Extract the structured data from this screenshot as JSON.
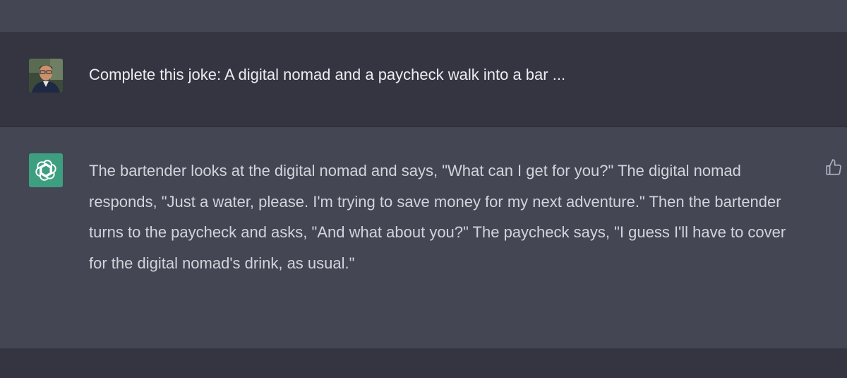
{
  "conversation": {
    "user_message": "Complete this joke: A digital nomad and a paycheck walk into a bar ...",
    "assistant_message": "The bartender looks at the digital nomad and says, \"What can I get for you?\" The digital nomad responds, \"Just a water, please. I'm trying to save money for my next adventure.\" Then the bartender turns to the paycheck and asks, \"And what about you?\" The paycheck says, \"I guess I'll have to cover for the digital nomad's drink, as usual.\""
  },
  "icons": {
    "user_avatar": "user-avatar-photo",
    "assistant_avatar": "openai-logo-icon",
    "feedback": "thumbs-up-icon"
  },
  "colors": {
    "accent": "#3e9f80",
    "assistant_bg": "#444654",
    "user_bg": "#343541",
    "text": "#d1d5db"
  }
}
